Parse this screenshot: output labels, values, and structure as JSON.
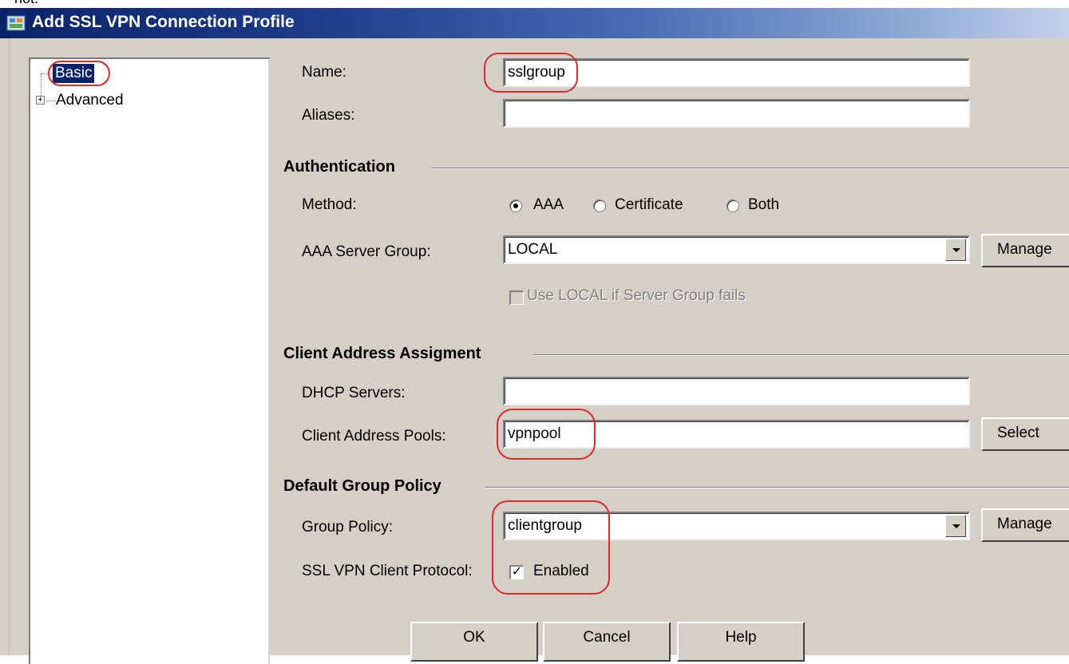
{
  "cropped_top_text": "not.",
  "window": {
    "title": "Add SSL VPN Connection Profile"
  },
  "tree": {
    "items": [
      {
        "label": "Basic",
        "selected": true
      },
      {
        "label": "Advanced",
        "expander": "+"
      }
    ]
  },
  "fields": {
    "name": {
      "label": "Name:",
      "value": "sslgroup"
    },
    "aliases": {
      "label": "Aliases:",
      "value": ""
    }
  },
  "authentication": {
    "section": "Authentication",
    "method_label": "Method:",
    "methods": [
      {
        "label": "AAA",
        "selected": true
      },
      {
        "label": "Certificate",
        "selected": false
      },
      {
        "label": "Both",
        "selected": false
      }
    ],
    "server_group_label": "AAA Server Group:",
    "server_group_value": "LOCAL",
    "manage_label": "Manage",
    "fallback_label": "Use LOCAL if Server Group fails",
    "fallback_checked": false,
    "fallback_enabled": false
  },
  "client_address": {
    "section": "Client Address Assigment",
    "dhcp_label": "DHCP Servers:",
    "dhcp_value": "",
    "pools_label": "Client Address Pools:",
    "pools_value": "vpnpool",
    "select_label": "Select"
  },
  "group_policy": {
    "section": "Default Group Policy",
    "policy_label": "Group Policy:",
    "policy_value": "clientgroup",
    "manage_label": "Manage",
    "protocol_label": "SSL VPN Client Protocol:",
    "protocol_checkbox_label": "Enabled",
    "protocol_checked": true
  },
  "buttons": {
    "ok": "OK",
    "cancel": "Cancel",
    "help": "Help"
  },
  "colors": {
    "titlebar_start": "#0a246a",
    "titlebar_end": "#c4d2ea",
    "dialog_bg": "#d4d0c8",
    "selection": "#0a246a",
    "annotation": "#e0282a"
  }
}
